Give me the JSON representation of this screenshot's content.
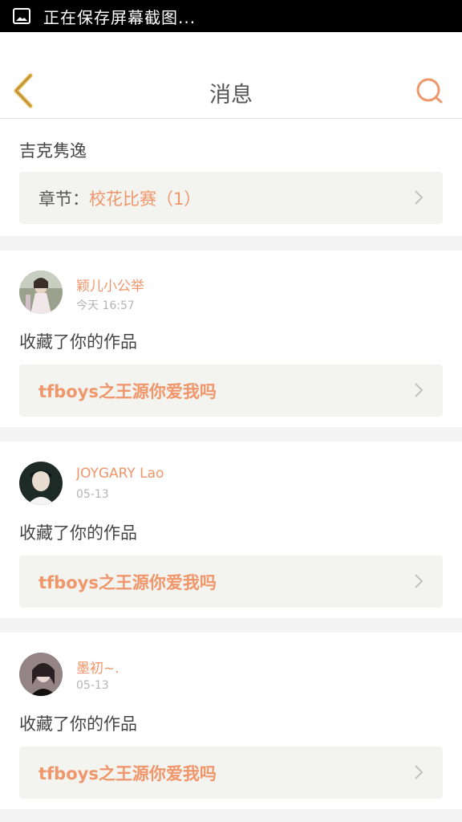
{
  "statusbar": {
    "text": "正在保存屏幕截图...",
    "icon": "image-icon"
  },
  "header": {
    "title": "消息",
    "back_icon": "chevron-left-icon",
    "search_icon": "search-icon"
  },
  "colors": {
    "accent": "#f0966b",
    "back_arrow": "#e6b24a",
    "text_primary": "#444444",
    "text_muted": "#b4b4b4",
    "work_box_bg": "#f3f3ef"
  },
  "messages": [
    {
      "user": "",
      "time": "",
      "action": "吉克隽逸",
      "chapter_label": "章节：",
      "work": "校花比赛（1）"
    },
    {
      "user": "颖儿小公举",
      "time": "今天 16:57",
      "action": "收藏了你的作品",
      "work": "tfboys之王源你爱我吗"
    },
    {
      "user": "JOYGARY Lao",
      "time": "05-13",
      "action": "收藏了你的作品",
      "work": "tfboys之王源你爱我吗"
    },
    {
      "user": "墨初~.",
      "time": "05-13",
      "action": "收藏了你的作品",
      "work": "tfboys之王源你爱我吗"
    }
  ]
}
